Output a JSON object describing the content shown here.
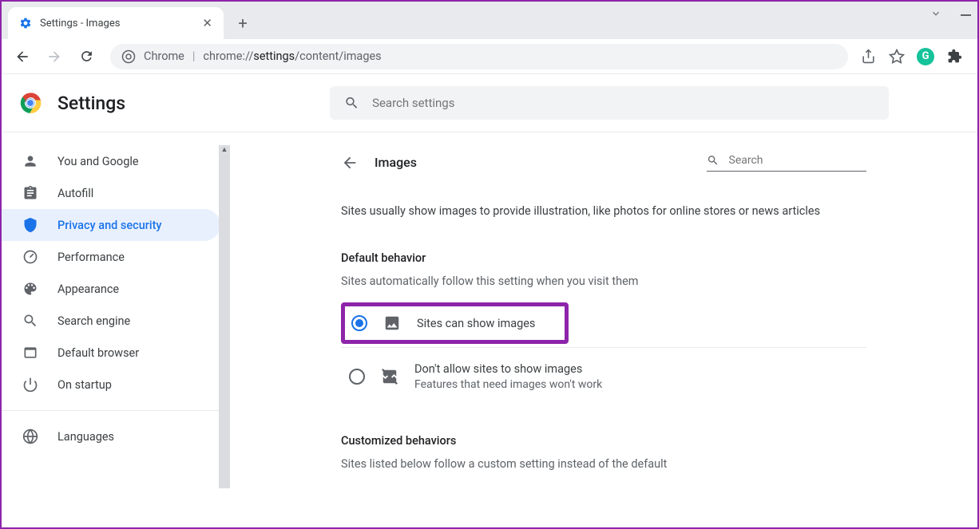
{
  "browser": {
    "tab_title": "Settings - Images",
    "omnibox_prefix": "Chrome",
    "omnibox_url_prefix": "chrome://",
    "omnibox_url_bold": "settings",
    "omnibox_url_suffix": "/content/images"
  },
  "header": {
    "title": "Settings",
    "search_placeholder": "Search settings"
  },
  "sidebar": {
    "items": [
      {
        "label": "You and Google"
      },
      {
        "label": "Autofill"
      },
      {
        "label": "Privacy and security"
      },
      {
        "label": "Performance"
      },
      {
        "label": "Appearance"
      },
      {
        "label": "Search engine"
      },
      {
        "label": "Default browser"
      },
      {
        "label": "On startup"
      }
    ],
    "extra": [
      {
        "label": "Languages"
      }
    ]
  },
  "page": {
    "title": "Images",
    "search_placeholder": "Search",
    "description": "Sites usually show images to provide illustration, like photos for online stores or news articles",
    "section1_title": "Default behavior",
    "section1_desc": "Sites automatically follow this setting when you visit them",
    "option1_label": "Sites can show images",
    "option2_label": "Don't allow sites to show images",
    "option2_sublabel": "Features that need images won't work",
    "section2_title": "Customized behaviors",
    "section2_desc": "Sites listed below follow a custom setting instead of the default"
  }
}
